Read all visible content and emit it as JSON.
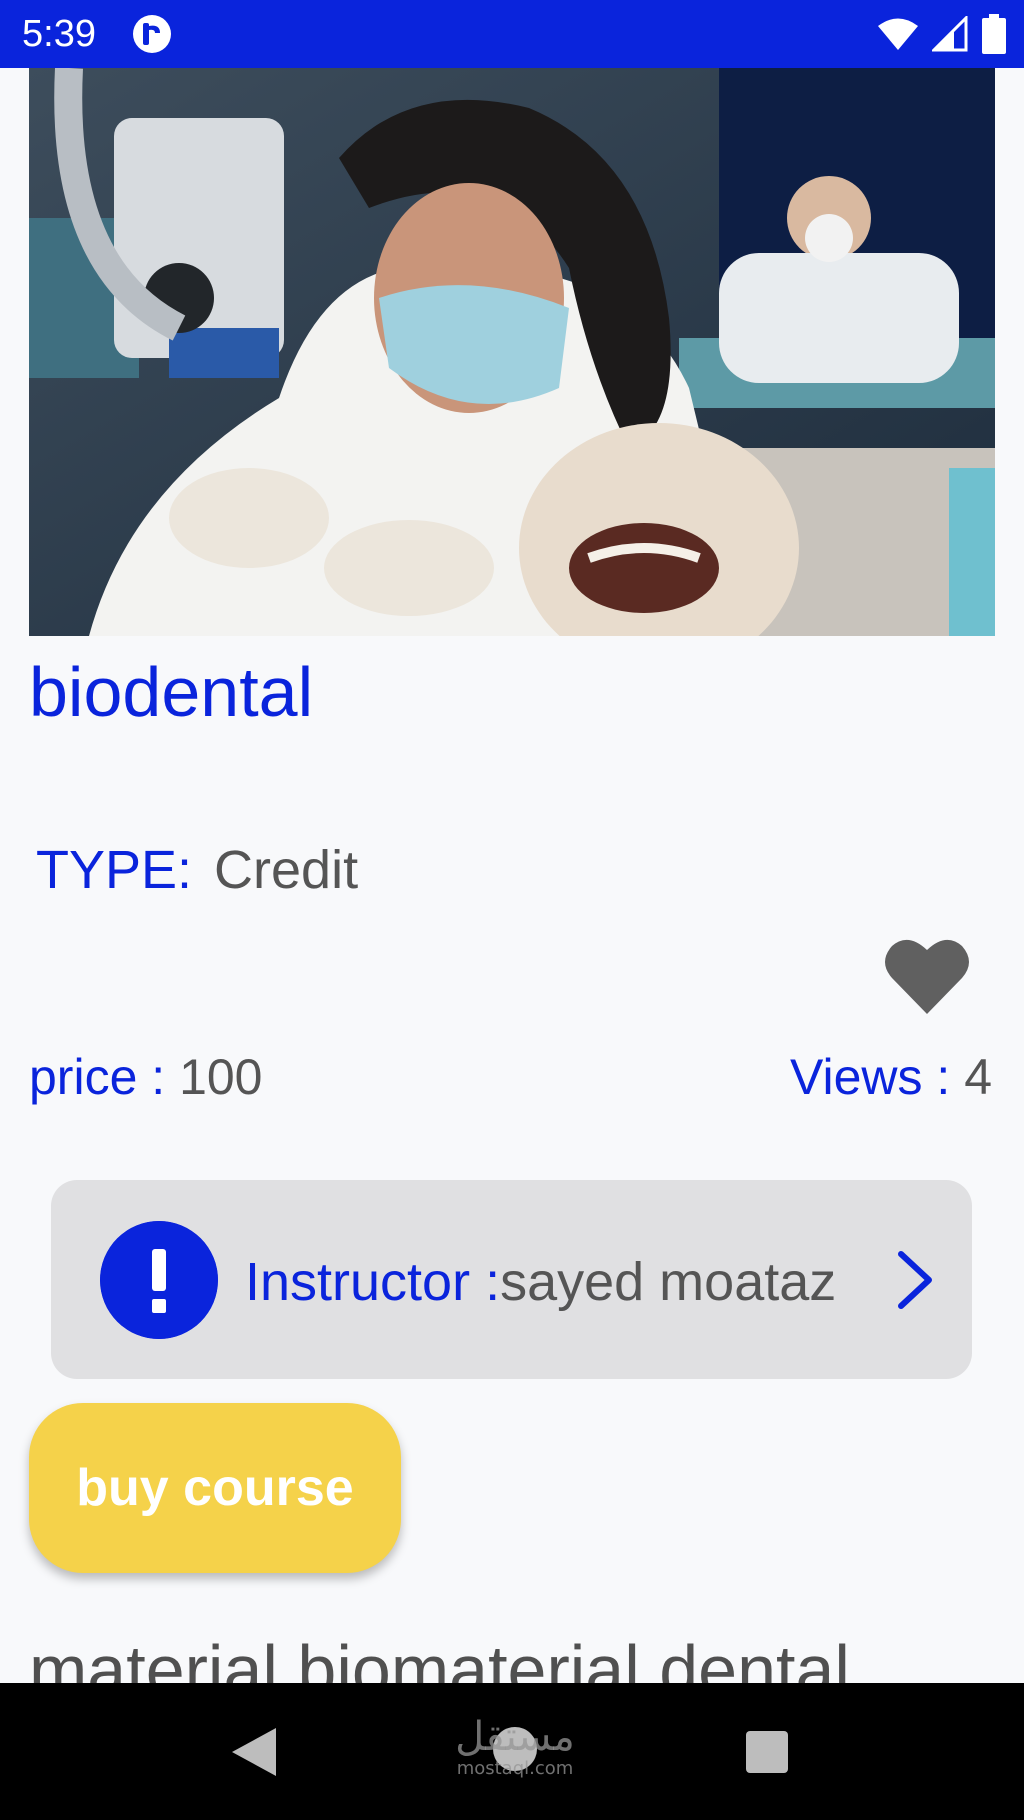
{
  "status_bar": {
    "time": "5:39",
    "background_color": "#0a24dc",
    "icons": [
      "app-notification-icon",
      "wifi-icon",
      "cellular-signal-icon",
      "battery-icon"
    ]
  },
  "hero_image": {
    "icon": "course-photo"
  },
  "course": {
    "title": "biodental",
    "type_label": "TYPE:",
    "type_value": "Credit",
    "price_label": "price : ",
    "price_value": "100",
    "views_label": "Views : ",
    "views_value": "4",
    "favorite_icon": "heart-icon",
    "description": "material biomaterial dental"
  },
  "instructor": {
    "label": "Instructor :",
    "name": "sayed moataz",
    "icon": "exclamation-icon",
    "chevron_icon": "chevron-right-icon"
  },
  "actions": {
    "buy_label": "buy course"
  },
  "nav_bar": {
    "watermark_arabic": "مستقل",
    "watermark_latin": "mostaql.com",
    "icons": [
      "back-icon",
      "home-icon",
      "recents-icon"
    ]
  },
  "colors": {
    "accent": "#0a24dc",
    "buy_button": "#f5d24a",
    "card": "#e0e0e2",
    "text_gray": "#555555"
  }
}
